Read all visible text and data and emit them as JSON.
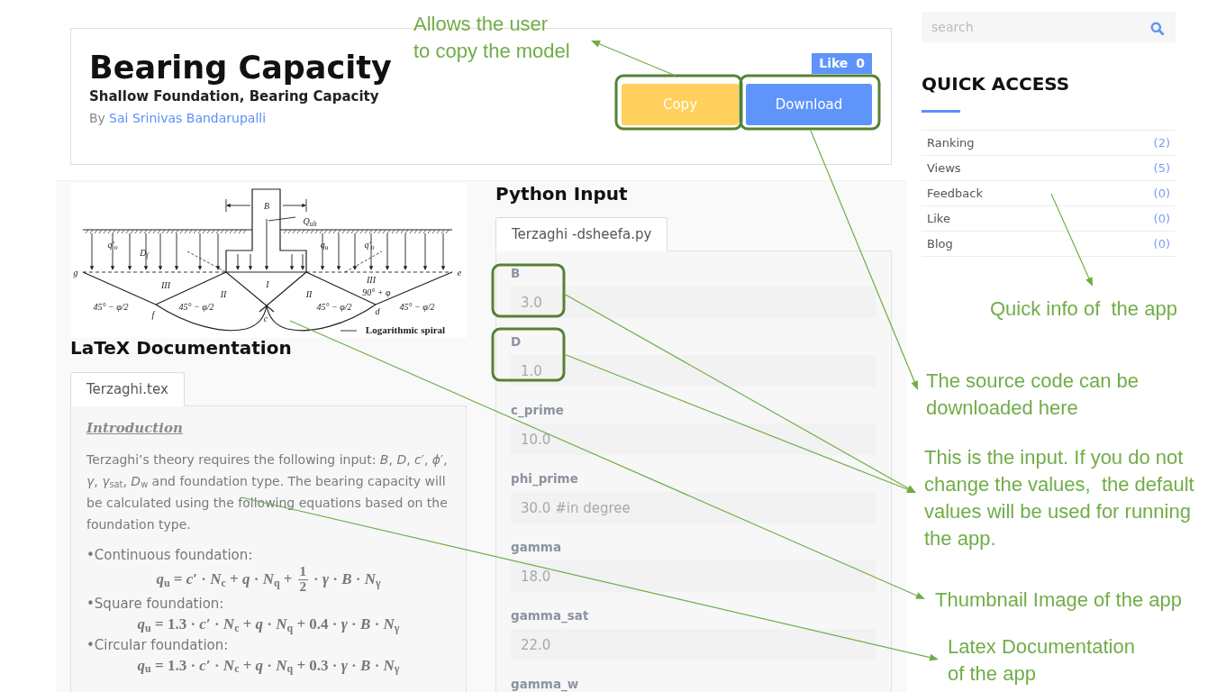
{
  "header": {
    "title": "Bearing Capacity",
    "subtitle": "Shallow Foundation, Bearing Capacity",
    "byline": {
      "prefix": "By",
      "author": "Sai Srinivas Bandarupalli"
    },
    "like_button": {
      "label": "Like",
      "count": "0"
    },
    "buttons": [
      {
        "label": "Copy",
        "kind": "warning"
      },
      {
        "label": "Download",
        "kind": "primary"
      }
    ]
  },
  "thumbnail": {
    "labels": [
      "B",
      "Q$_{ult}$",
      "q′$_{o}$",
      "D$_{f}$",
      "q$_{u}$",
      "q′$_{o}$",
      "g",
      "e",
      "III",
      "I",
      "III",
      "II",
      "II",
      "90° + φ",
      "45° − φ/2",
      "45° − φ/2",
      "45° − φ/2",
      "45° − φ/2",
      "f",
      "c",
      "d",
      "Logarithmic spiral"
    ]
  },
  "latex_documentation": {
    "heading": "LaTeX Documentation",
    "tabs": [
      {
        "label": "Terzaghi.tex",
        "selected": true
      }
    ],
    "section_title": "Introduction",
    "blocks": [
      {
        "kind": "paragraph",
        "text": "Terzaghi’s theory requires the following input: *B*, *D*, *c*′, *ϕ*′, *γ*, *γ*$_{sat}$, *D*$_{w}$ and foundation type. The bearing capacity will be calculated using the following equations based on the foundation type."
      },
      {
        "kind": "bullet",
        "text": "•Continuous foundation:"
      },
      {
        "kind": "equation",
        "parts": [
          {
            "kind": "text",
            "text": "*q*$_{u}$ = *c*′ · *N*$_{c}$ + *q* · *N*$_{q}$ +"
          },
          {
            "kind": "fraction",
            "numerator": "1",
            "denominator": "2"
          },
          {
            "kind": "text",
            "text": "· *γ* · *B* · *N*$_{γ}$"
          }
        ]
      },
      {
        "kind": "bullet",
        "text": "•Square foundation:"
      },
      {
        "kind": "equation",
        "parts": [
          {
            "kind": "text",
            "text": "*q*$_{u}$ = 1.3 · *c*′ · *N*$_{c}$ + *q* · *N*$_{q}$ + 0.4 · *γ* · *B* · *N*$_{γ}$"
          }
        ]
      },
      {
        "kind": "bullet",
        "text": "•Circular foundation:"
      },
      {
        "kind": "equation",
        "parts": [
          {
            "kind": "text",
            "text": "*q*$_{u}$ = 1.3 · *c*′ · *N*$_{c}$ + *q* · *N*$_{q}$ + 0.3 · *γ* · *B* · *N*$_{γ}$"
          }
        ]
      }
    ]
  },
  "python_input": {
    "heading": "Python Input",
    "tabs": [
      {
        "label": "Terzaghi -dsheefa.py",
        "selected": true
      }
    ],
    "fields": [
      {
        "label": "B",
        "placeholder": "3.0"
      },
      {
        "label": "D",
        "placeholder": "1.0"
      },
      {
        "label": "c_prime",
        "placeholder": "10.0"
      },
      {
        "label": "phi_prime",
        "placeholder": "30.0 #in degree"
      },
      {
        "label": "gamma",
        "placeholder": "18.0"
      },
      {
        "label": "gamma_sat",
        "placeholder": "22.0"
      },
      {
        "label": "gamma_w"
      }
    ]
  },
  "sidebar": {
    "search": {
      "placeholder": "search"
    },
    "heading": "QUICK ACCESS",
    "items": [
      {
        "label": "Ranking",
        "count": "(2)"
      },
      {
        "label": "Views",
        "count": "(5)"
      },
      {
        "label": "Feedback",
        "count": "(0)"
      },
      {
        "label": "Like",
        "count": "(0)"
      },
      {
        "label": "Blog",
        "count": "(0)"
      }
    ]
  },
  "annotations": [
    {
      "text": "Allows the user\nto copy the model"
    },
    {
      "text": "Quick info of  the app"
    },
    {
      "text": "The source code can be\ndownloaded here"
    },
    {
      "text": "This is the input. If you do not\nchange the values,  the default\nvalues will be used for running\nthe app."
    },
    {
      "text": "Thumbnail Image of the app"
    },
    {
      "text": "Latex Documentation\nof the app"
    }
  ]
}
